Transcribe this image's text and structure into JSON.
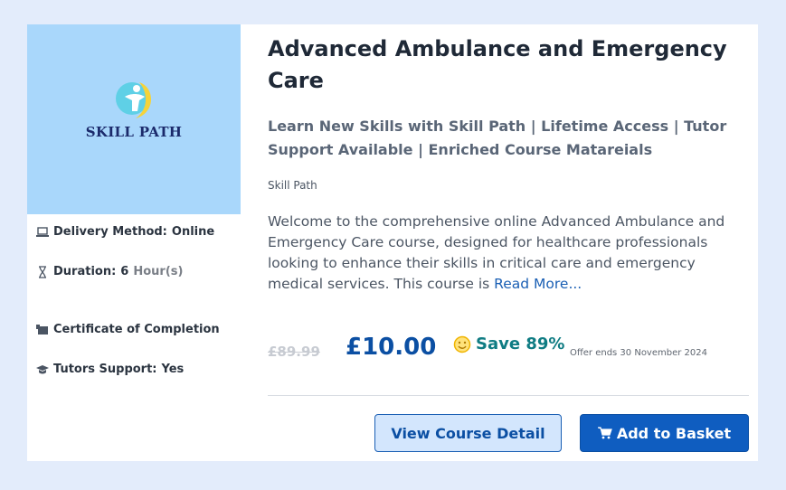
{
  "brand": {
    "name": "SKILL PATH",
    "colors": {
      "thumb_bg": "#a9d7fb",
      "accent": "#0f5dc0",
      "save": "#0f7c83"
    }
  },
  "course": {
    "title": "Advanced Ambulance and Emergency Care",
    "subtitle": "Learn New Skills with Skill Path | Lifetime Access | Tutor Support Available | Enriched Course Matareials",
    "provider": "Skill Path",
    "description": "Welcome to the comprehensive online Advanced Ambulance and Emergency Care course, designed for healthcare professionals looking to enhance their skills in critical care and emergency medical services. This course is",
    "read_more": "Read More..."
  },
  "meta": {
    "delivery": {
      "icon": "laptop-icon",
      "label": "Delivery Method:",
      "value": "Online"
    },
    "duration": {
      "icon": "hourglass-icon",
      "label": "Duration:",
      "value": "6",
      "unit": "Hour(s)"
    },
    "certificate": {
      "icon": "certificate-icon",
      "label": "Certificate of Completion"
    },
    "tutors": {
      "icon": "graduation-cap-icon",
      "label": "Tutors Support:",
      "value": "Yes"
    }
  },
  "pricing": {
    "old_price": "£89.99",
    "price": "£10.00",
    "save_label": "Save 89%",
    "save_icon": "smiley-icon",
    "offer_text": "Offer ends 30 November 2024"
  },
  "actions": {
    "view_detail": "View Course Detail",
    "add_to_basket": "Add to Basket",
    "basket_icon": "cart-icon"
  }
}
